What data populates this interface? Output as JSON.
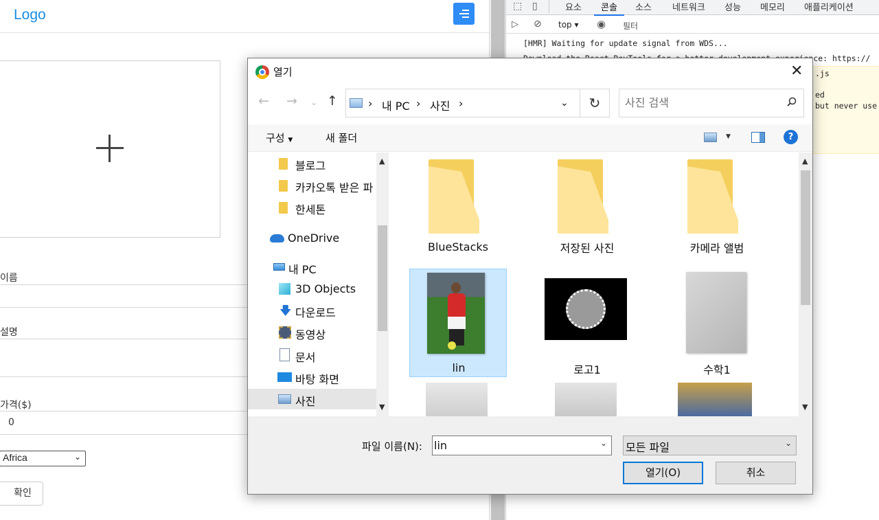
{
  "page": {
    "logo": "Logo",
    "fields": {
      "name_label": "이름",
      "desc_label": "설명",
      "price_label": "가격($)",
      "price_value": "0",
      "region_value": "Africa",
      "submit_label": "확인"
    }
  },
  "devtools": {
    "tabs": [
      "요소",
      "콘솔",
      "소스",
      "네트워크",
      "성능",
      "메모리",
      "애플리케이션"
    ],
    "active_tab": "콘솔",
    "context": "top",
    "filter_placeholder": "필터",
    "console_lines": [
      "[HMR] Waiting for update signal from WDS...",
      "Download the React DevTools for a better development experience: https://",
      ".js",
      "ed",
      "but never use"
    ]
  },
  "dialog": {
    "title": "열기",
    "breadcrumb": [
      "내 PC",
      "사진"
    ],
    "search_placeholder": "사진 검색",
    "organize": "구성",
    "new_folder": "새 폴더",
    "help": "?",
    "nav_items": [
      {
        "label": "블로그",
        "icon": "folder-icon"
      },
      {
        "label": "카카오톡 받은 파",
        "icon": "folder-icon"
      },
      {
        "label": "한세톤",
        "icon": "folder-icon"
      },
      {
        "label": "OneDrive",
        "icon": "cloud-icon"
      },
      {
        "label": "내 PC",
        "icon": "pc-icon"
      },
      {
        "label": "3D Objects",
        "icon": "cube-icon"
      },
      {
        "label": "다운로드",
        "icon": "download-icon"
      },
      {
        "label": "동영상",
        "icon": "video-icon"
      },
      {
        "label": "문서",
        "icon": "document-icon"
      },
      {
        "label": "바탕 화면",
        "icon": "desktop-icon"
      },
      {
        "label": "사진",
        "icon": "pictures-icon"
      }
    ],
    "selected_nav": "사진",
    "files": [
      "BlueStacks",
      "저장된 사진",
      "카메라 앨범",
      "lin",
      "로고1",
      "수학1"
    ],
    "selected_file": "lin",
    "filename_label": "파일 이름(N):",
    "filename_value": "lin",
    "filetype_value": "모든 파일",
    "open_button": "열기(O)",
    "cancel_button": "취소"
  }
}
